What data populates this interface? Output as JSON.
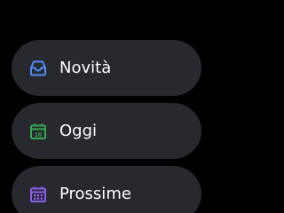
{
  "menu": {
    "items": [
      {
        "label": "Novità",
        "icon": "inbox-icon",
        "icon_color": "#4f8ef7"
      },
      {
        "label": "Oggi",
        "icon": "calendar-today-icon",
        "icon_color": "#34a853",
        "icon_text": "16"
      },
      {
        "label": "Prossime",
        "icon": "calendar-upcoming-icon",
        "icon_color": "#8e5cf0"
      }
    ]
  },
  "theme": {
    "background": "#000000",
    "chip_background": "#27292e",
    "text_color": "#ffffff"
  }
}
